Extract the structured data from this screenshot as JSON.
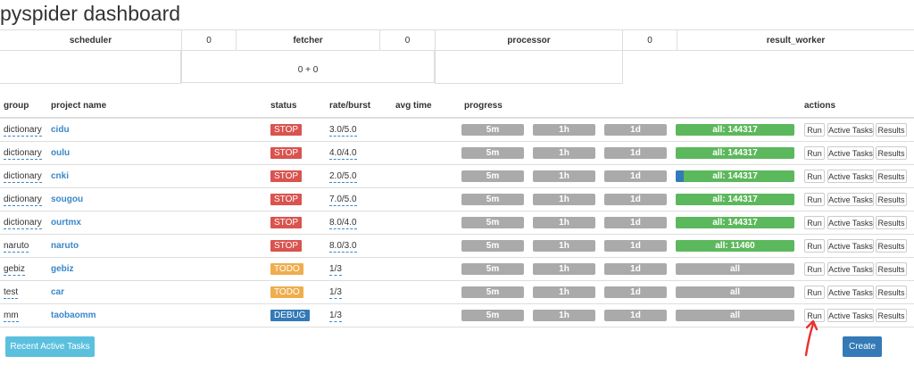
{
  "title": "pyspider dashboard",
  "queues": {
    "scheduler_label": "scheduler",
    "scheduler_to_fetcher": "0",
    "fetcher_label": "fetcher",
    "fetcher_to_processor": "0",
    "processor_label": "processor",
    "processor_to_result": "0",
    "result_label": "result_worker",
    "fetcher_sum": "0 + 0"
  },
  "headers": {
    "group": "group",
    "project": "project name",
    "status": "status",
    "rate": "rate/burst",
    "avg": "avg time",
    "progress": "progress",
    "actions": "actions"
  },
  "buttons": {
    "run": "Run",
    "active": "Active Tasks",
    "results": "Results"
  },
  "projects": [
    {
      "group": "dictionary",
      "name": "cidu",
      "status": "STOP",
      "rate": "3.0/5.0",
      "p5m": "5m",
      "p1h": "1h",
      "p1d": "1d",
      "all": "all: 144317",
      "all_done": 1.0,
      "all_pending": 0
    },
    {
      "group": "dictionary",
      "name": "oulu",
      "status": "STOP",
      "rate": "4.0/4.0",
      "p5m": "5m",
      "p1h": "1h",
      "p1d": "1d",
      "all": "all: 144317",
      "all_done": 1.0,
      "all_pending": 0
    },
    {
      "group": "dictionary",
      "name": "cnki",
      "status": "STOP",
      "rate": "2.0/5.0",
      "p5m": "5m",
      "p1h": "1h",
      "p1d": "1d",
      "all": "all: 144317",
      "all_done": 1.0,
      "all_pending": 0.07
    },
    {
      "group": "dictionary",
      "name": "sougou",
      "status": "STOP",
      "rate": "7.0/5.0",
      "p5m": "5m",
      "p1h": "1h",
      "p1d": "1d",
      "all": "all: 144317",
      "all_done": 1.0,
      "all_pending": 0
    },
    {
      "group": "dictionary",
      "name": "ourtmx",
      "status": "STOP",
      "rate": "8.0/4.0",
      "p5m": "5m",
      "p1h": "1h",
      "p1d": "1d",
      "all": "all: 144317",
      "all_done": 1.0,
      "all_pending": 0
    },
    {
      "group": "naruto",
      "name": "naruto",
      "status": "STOP",
      "rate": "8.0/3.0",
      "p5m": "5m",
      "p1h": "1h",
      "p1d": "1d",
      "all": "all: 11460",
      "all_done": 1.0,
      "all_pending": 0
    },
    {
      "group": "gebiz",
      "name": "gebiz",
      "status": "TODO",
      "rate": "1/3",
      "p5m": "5m",
      "p1h": "1h",
      "p1d": "1d",
      "all": "all",
      "all_done": 0,
      "all_pending": 0
    },
    {
      "group": "test",
      "name": "car",
      "status": "TODO",
      "rate": "1/3",
      "p5m": "5m",
      "p1h": "1h",
      "p1d": "1d",
      "all": "all",
      "all_done": 0,
      "all_pending": 0
    },
    {
      "group": "mm",
      "name": "taobaomm",
      "status": "DEBUG",
      "rate": "1/3",
      "p5m": "5m",
      "p1h": "1h",
      "p1d": "1d",
      "all": "all",
      "all_done": 0,
      "all_pending": 0
    }
  ],
  "footer": {
    "recent": "Recent Active Tasks",
    "create": "Create"
  },
  "colors": {
    "stop": "#d9534f",
    "todo": "#f0ad4e",
    "debug": "#337ab7",
    "success": "#5cb85c",
    "link": "#3a87c9"
  }
}
